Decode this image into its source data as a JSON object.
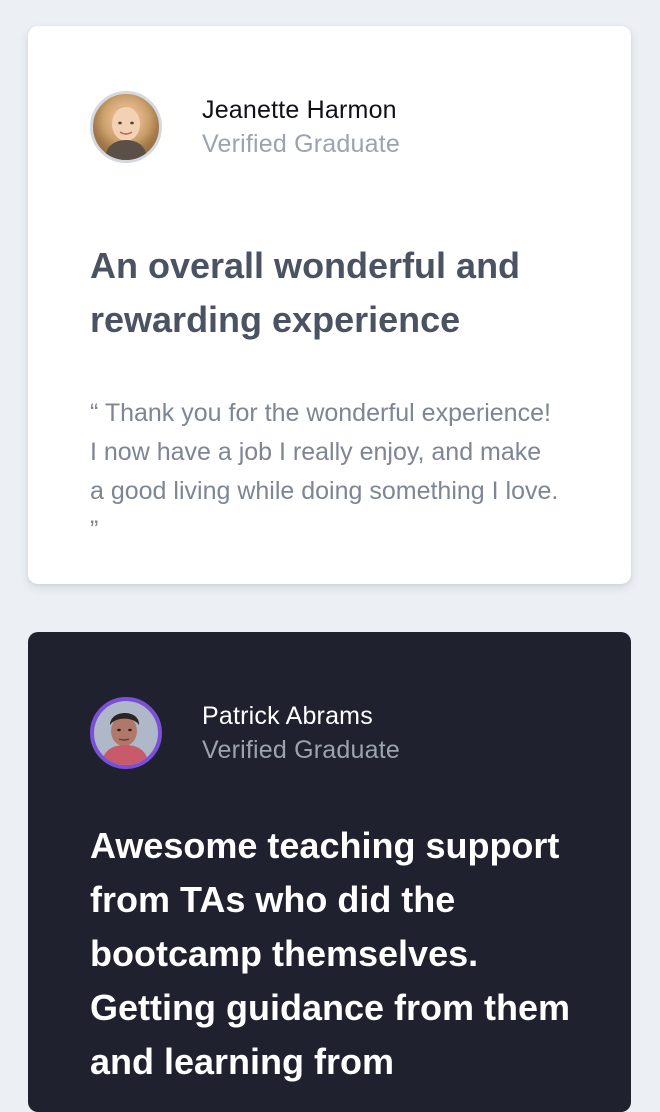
{
  "testimonials": [
    {
      "name": "Jeanette Harmon",
      "role": "Verified Graduate",
      "headline": "An overall wonderful and rewarding experience",
      "quote": "“ Thank you for the wonderful experience! I now have a job I really enjoy, and make a good living while doing something I love. ”",
      "theme": "light",
      "avatar_ring_color": "#d4d8df"
    },
    {
      "name": "Patrick Abrams",
      "role": "Verified Graduate",
      "headline": "Awesome teaching support from TAs who did the bootcamp themselves. Getting guidance from them and learning from",
      "theme": "dark",
      "avatar_ring_color": "#7b50d9"
    }
  ],
  "colors": {
    "page_background": "#ecf0f5",
    "light_card_background": "#ffffff",
    "dark_card_background": "#1f212e",
    "accent_purple": "#7b50d9",
    "muted_text": "#9ca3af"
  }
}
